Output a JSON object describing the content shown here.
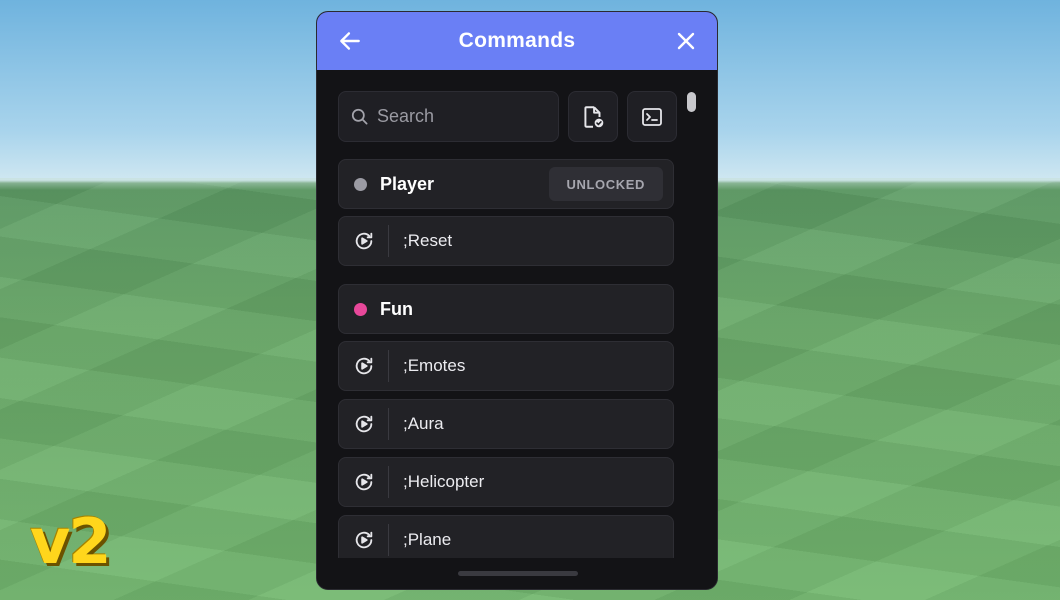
{
  "overlay": {
    "version": "v2"
  },
  "panel": {
    "title": "Commands",
    "accent_color": "#6a7ff5",
    "background_color": "#131316",
    "search": {
      "placeholder": "Search",
      "value": ""
    },
    "toolbar": {
      "icons": [
        "file-check-icon",
        "terminal-icon"
      ]
    },
    "categories": [
      {
        "name": "Player",
        "dot_color": "#9b9ba3",
        "badge": "UNLOCKED",
        "commands": [
          ";Reset"
        ]
      },
      {
        "name": "Fun",
        "dot_color": "#e8489a",
        "commands": [
          ";Emotes",
          ";Aura",
          ";Helicopter",
          ";Plane"
        ]
      }
    ]
  }
}
